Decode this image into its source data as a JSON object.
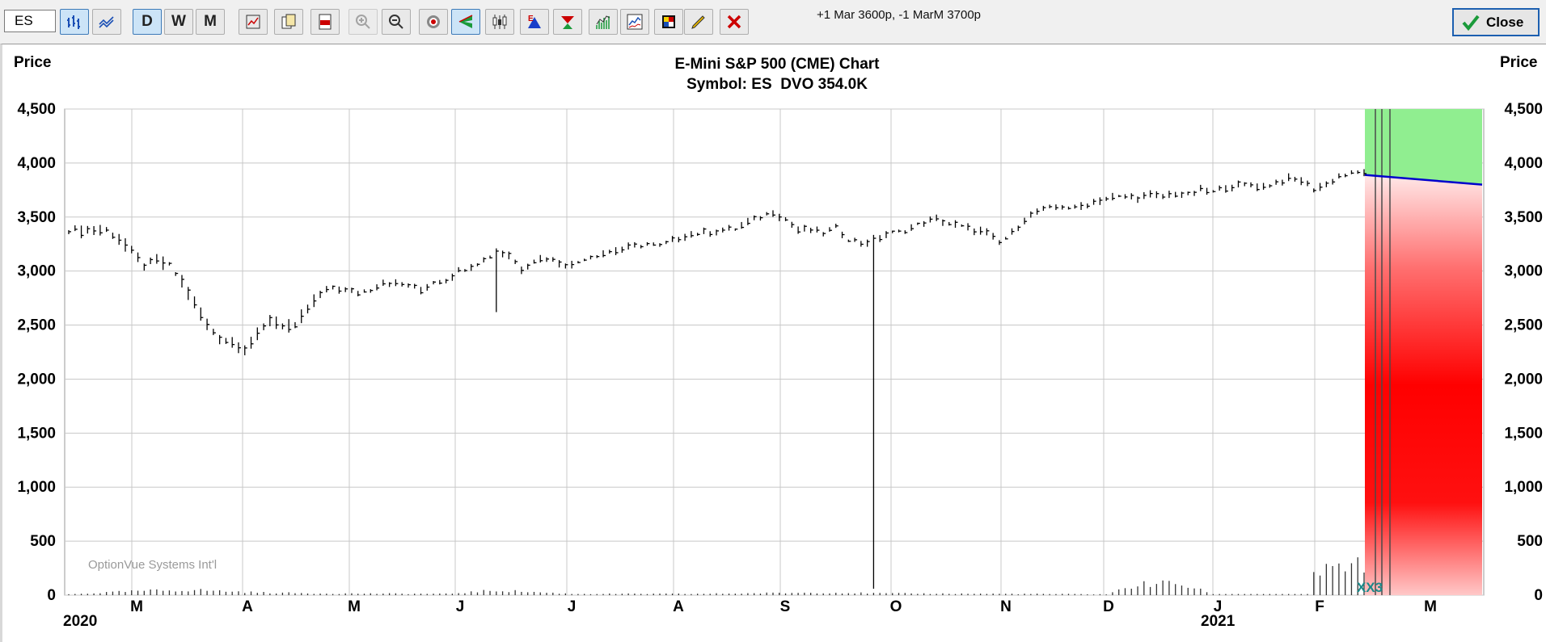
{
  "toolbar": {
    "symbol": "ES",
    "buttons": [
      {
        "name": "bar-chart-icon",
        "active": true
      },
      {
        "name": "line-chart-icon",
        "active": false
      },
      {
        "name": "daily-button",
        "label": "D",
        "active": true
      },
      {
        "name": "weekly-button",
        "label": "W",
        "active": false
      },
      {
        "name": "monthly-button",
        "label": "M",
        "active": false
      },
      {
        "name": "chart-settings-icon",
        "active": false
      },
      {
        "name": "copy-icon",
        "active": false
      },
      {
        "name": "export-pdf-icon",
        "active": false
      },
      {
        "name": "zoom-in-icon",
        "active": false,
        "disabled": true
      },
      {
        "name": "zoom-out-icon",
        "active": false
      },
      {
        "name": "target-icon",
        "active": false
      },
      {
        "name": "volume-cone-icon",
        "active": true
      },
      {
        "name": "candlestick-icon",
        "active": false
      },
      {
        "name": "earnings-icon",
        "active": false
      },
      {
        "name": "dividend-icon",
        "active": false
      },
      {
        "name": "bars-icon",
        "active": false
      },
      {
        "name": "indicators-icon",
        "active": false
      },
      {
        "name": "palette-icon",
        "active": false
      },
      {
        "name": "pencil-icon",
        "active": false
      },
      {
        "name": "delete-icon",
        "active": false
      }
    ],
    "order_text": "+1 Mar 3600p, -1 MarM 3700p",
    "close_label": "Close"
  },
  "chart_data": {
    "type": "bar",
    "title": "E-Mini S&P 500 (CME) Chart",
    "subtitle": "Symbol: ES  DVO 354.0K",
    "ylabel_left": "Price",
    "ylabel_right": "Price",
    "ylim": [
      0,
      4500
    ],
    "yticks": [
      0,
      500,
      1000,
      1500,
      2000,
      2500,
      3000,
      3500,
      4000,
      4500
    ],
    "ytick_labels": [
      "0",
      "500",
      "1,000",
      "1,500",
      "2,000",
      "2,500",
      "3,000",
      "3,500",
      "4,000",
      "4,500"
    ],
    "x_month_labels": [
      "M",
      "A",
      "M",
      "J",
      "J",
      "A",
      "S",
      "O",
      "N",
      "D",
      "J",
      "F",
      "M"
    ],
    "year_labels": [
      "2020",
      "2021"
    ],
    "watermark": "OptionVue Systems Int'l",
    "expiration_marker": "XX3",
    "grid": true,
    "price_path": [
      [
        0,
        3380
      ],
      [
        6,
        3380
      ],
      [
        8,
        3300
      ],
      [
        10,
        3180
      ],
      [
        12,
        3050
      ],
      [
        14,
        3100
      ],
      [
        16,
        3050
      ],
      [
        18,
        2900
      ],
      [
        20,
        2700
      ],
      [
        22,
        2500
      ],
      [
        24,
        2380
      ],
      [
        26,
        2340
      ],
      [
        28,
        2280
      ],
      [
        30,
        2400
      ],
      [
        32,
        2550
      ],
      [
        34,
        2500
      ],
      [
        36,
        2480
      ],
      [
        38,
        2650
      ],
      [
        40,
        2780
      ],
      [
        42,
        2850
      ],
      [
        44,
        2820
      ],
      [
        46,
        2800
      ],
      [
        48,
        2830
      ],
      [
        50,
        2900
      ],
      [
        52,
        2880
      ],
      [
        54,
        2870
      ],
      [
        56,
        2820
      ],
      [
        58,
        2900
      ],
      [
        60,
        2920
      ],
      [
        62,
        3000
      ],
      [
        64,
        3050
      ],
      [
        66,
        3100
      ],
      [
        68,
        3180
      ],
      [
        70,
        3150
      ],
      [
        72,
        3020
      ],
      [
        74,
        3100
      ],
      [
        76,
        3120
      ],
      [
        78,
        3080
      ],
      [
        80,
        3050
      ],
      [
        82,
        3120
      ],
      [
        84,
        3150
      ],
      [
        86,
        3180
      ],
      [
        88,
        3200
      ],
      [
        90,
        3230
      ],
      [
        92,
        3250
      ],
      [
        94,
        3230
      ],
      [
        96,
        3280
      ],
      [
        98,
        3330
      ],
      [
        100,
        3350
      ],
      [
        102,
        3360
      ],
      [
        104,
        3380
      ],
      [
        106,
        3390
      ],
      [
        108,
        3450
      ],
      [
        110,
        3500
      ],
      [
        112,
        3550
      ],
      [
        114,
        3480
      ],
      [
        116,
        3380
      ],
      [
        118,
        3380
      ],
      [
        120,
        3350
      ],
      [
        122,
        3400
      ],
      [
        124,
        3300
      ],
      [
        126,
        3260
      ],
      [
        128,
        3280
      ],
      [
        130,
        3340
      ],
      [
        132,
        3360
      ],
      [
        134,
        3400
      ],
      [
        136,
        3450
      ],
      [
        138,
        3480
      ],
      [
        140,
        3440
      ],
      [
        142,
        3410
      ],
      [
        144,
        3380
      ],
      [
        146,
        3350
      ],
      [
        148,
        3260
      ],
      [
        150,
        3350
      ],
      [
        152,
        3480
      ],
      [
        154,
        3550
      ],
      [
        156,
        3580
      ],
      [
        158,
        3600
      ],
      [
        160,
        3580
      ],
      [
        162,
        3620
      ],
      [
        164,
        3660
      ],
      [
        166,
        3680
      ],
      [
        168,
        3690
      ],
      [
        170,
        3680
      ],
      [
        172,
        3700
      ],
      [
        174,
        3690
      ],
      [
        176,
        3720
      ],
      [
        178,
        3700
      ],
      [
        180,
        3750
      ],
      [
        182,
        3730
      ],
      [
        184,
        3780
      ],
      [
        186,
        3790
      ],
      [
        188,
        3800
      ],
      [
        190,
        3780
      ],
      [
        192,
        3820
      ],
      [
        194,
        3850
      ],
      [
        196,
        3840
      ],
      [
        198,
        3760
      ],
      [
        200,
        3800
      ],
      [
        202,
        3880
      ],
      [
        204,
        3900
      ],
      [
        206,
        3920
      ]
    ],
    "dip_spikes": [
      {
        "t": 68,
        "low": 2620
      },
      {
        "t": 128,
        "low": 60
      }
    ],
    "volume_path": [
      [
        0,
        10
      ],
      [
        12,
        50
      ],
      [
        20,
        60
      ],
      [
        30,
        30
      ],
      [
        40,
        20
      ],
      [
        60,
        15
      ],
      [
        68,
        55
      ],
      [
        80,
        15
      ],
      [
        100,
        15
      ],
      [
        120,
        30
      ],
      [
        130,
        20
      ],
      [
        150,
        15
      ],
      [
        165,
        10
      ],
      [
        170,
        120
      ],
      [
        176,
        140
      ],
      [
        182,
        15
      ],
      [
        195,
        15
      ],
      [
        198,
        260
      ],
      [
        206,
        350
      ]
    ],
    "forecast": {
      "start_price": 3890,
      "end_price": 3800,
      "line_color": "#0000cc",
      "upper_zone_color": "#90ee90",
      "lower_zone_color": "#ff0000"
    }
  }
}
